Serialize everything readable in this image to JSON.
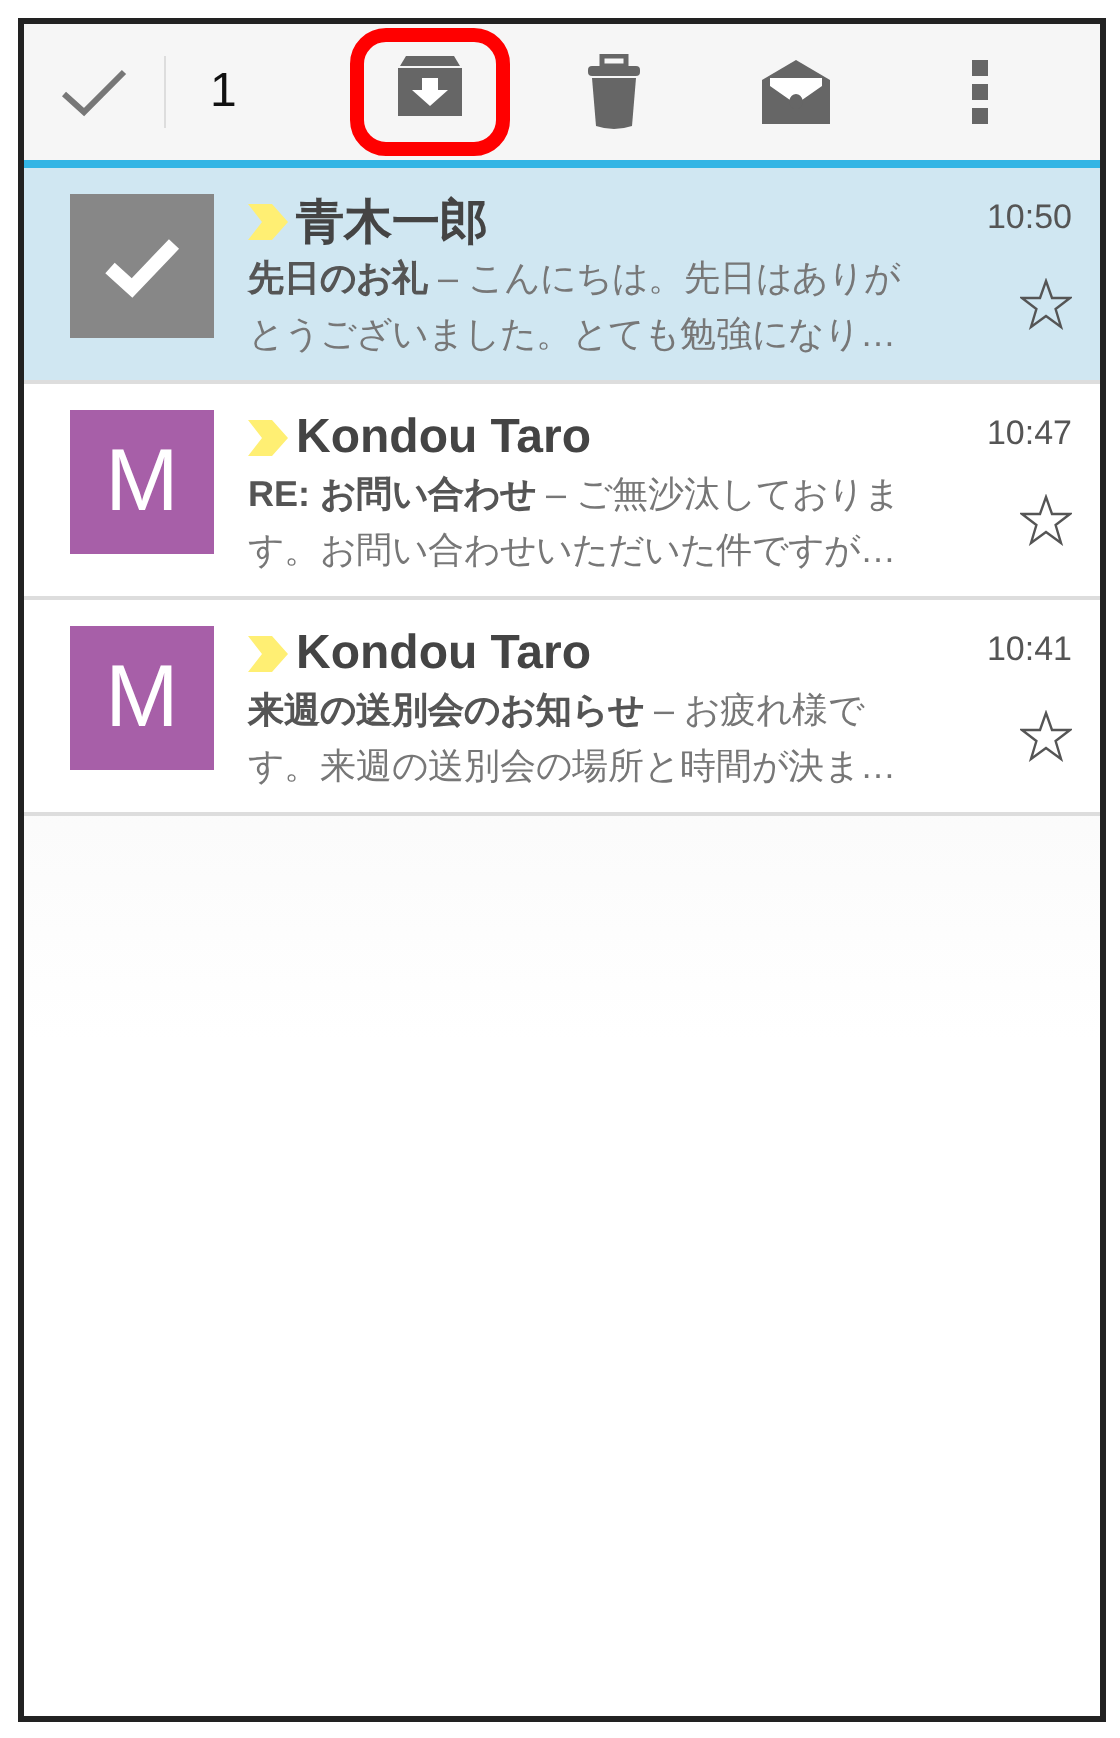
{
  "toolbar": {
    "selection_count": "1",
    "actions": [
      {
        "kind": "archive",
        "highlighted": true
      },
      {
        "kind": "delete",
        "highlighted": false
      },
      {
        "kind": "mark-read",
        "highlighted": false
      },
      {
        "kind": "more",
        "highlighted": false
      }
    ]
  },
  "messages": [
    {
      "selected": true,
      "important": true,
      "sender": "青木一郎",
      "time": "10:50",
      "preview": [
        "**先日のお礼** – こんにちは。先日はありが",
        "とうございました。とても勉強になり…"
      ],
      "starred": false
    },
    {
      "selected": false,
      "avatar_letter": "M",
      "color": "#a75fa8",
      "important": true,
      "sender": "Kondou Taro",
      "time": "10:47",
      "preview": [
        "**RE: お問い合わせ** – ご無沙汰しておりま",
        "す。お問い合わせいただいた件ですが…"
      ],
      "starred": false
    },
    {
      "selected": false,
      "avatar_letter": "M",
      "color": "#a75fa8",
      "important": true,
      "sender": "Kondou Taro",
      "time": "10:41",
      "preview": [
        "**来週の送別会のお知らせ** – お疲れ様で",
        "す。来週の送別会の場所と時間が決ま…"
      ],
      "starred": false
    }
  ]
}
